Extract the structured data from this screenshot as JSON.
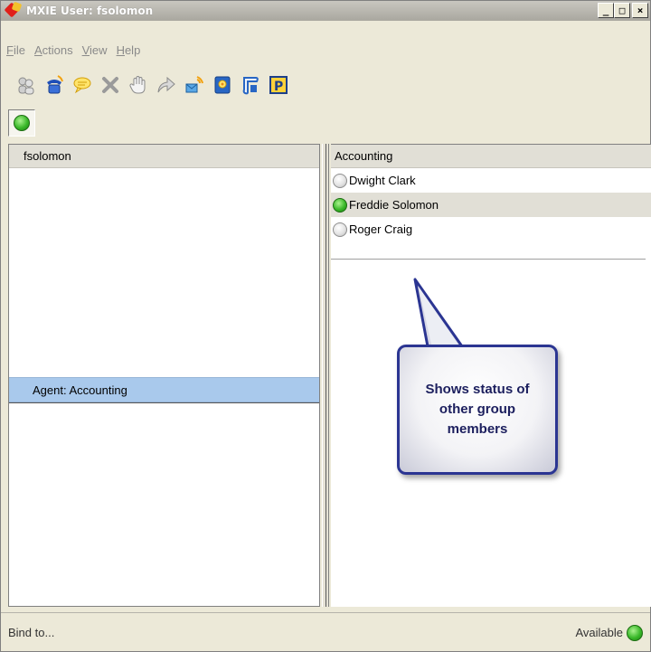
{
  "window": {
    "title": "MXIE User: fsolomon",
    "minimize": "_",
    "maximize": "□",
    "close": "×"
  },
  "menu": [
    "File",
    "Actions",
    "View",
    "Help"
  ],
  "toolbar_icons": [
    "users-icon",
    "phone-icon",
    "chat-icon",
    "cancel-icon",
    "hand-icon",
    "forward-icon",
    "voicemail-icon",
    "contacts-icon",
    "call-log-icon",
    "park-icon"
  ],
  "left_panel": {
    "header": "fsolomon",
    "group_header": "Agent: Accounting"
  },
  "right_panel": {
    "header": "Accounting",
    "members": [
      {
        "name": "Dwight Clark",
        "status": "offline"
      },
      {
        "name": "Freddie Solomon",
        "status": "available"
      },
      {
        "name": "Roger Craig",
        "status": "offline"
      }
    ]
  },
  "callout": {
    "text": "Shows status of other group members"
  },
  "statusbar": {
    "left": "Bind to...",
    "right": "Available"
  },
  "colors": {
    "accent": "#2b3592",
    "available": "#3ab82a",
    "selection": "#a9c9ec"
  }
}
